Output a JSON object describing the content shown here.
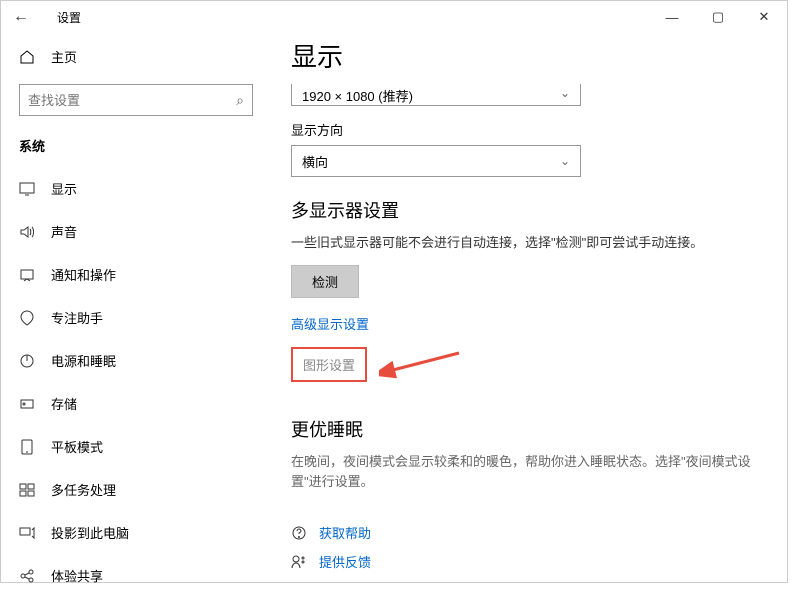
{
  "window": {
    "title": "设置"
  },
  "sidebar": {
    "home": "主页",
    "searchPlaceholder": "查找设置",
    "section": "系统",
    "items": [
      {
        "label": "显示"
      },
      {
        "label": "声音"
      },
      {
        "label": "通知和操作"
      },
      {
        "label": "专注助手"
      },
      {
        "label": "电源和睡眠"
      },
      {
        "label": "存储"
      },
      {
        "label": "平板模式"
      },
      {
        "label": "多任务处理"
      },
      {
        "label": "投影到此电脑"
      },
      {
        "label": "体验共享"
      }
    ]
  },
  "main": {
    "heading": "显示",
    "resolution": "1920 × 1080 (推荐)",
    "orientationLabel": "显示方向",
    "orientation": "横向",
    "multiHeading": "多显示器设置",
    "multiDesc": "一些旧式显示器可能不会进行自动连接，选择\"检测\"即可尝试手动连接。",
    "detectBtn": "检测",
    "advLink": "高级显示设置",
    "gfxLink": "图形设置",
    "sleepHeading": "更优睡眠",
    "sleepDesc": "在晚间，夜间模式会显示较柔和的暖色，帮助你进入睡眠状态。选择\"夜间模式设置\"进行设置。",
    "helpLink": "获取帮助",
    "feedbackLink": "提供反馈"
  }
}
